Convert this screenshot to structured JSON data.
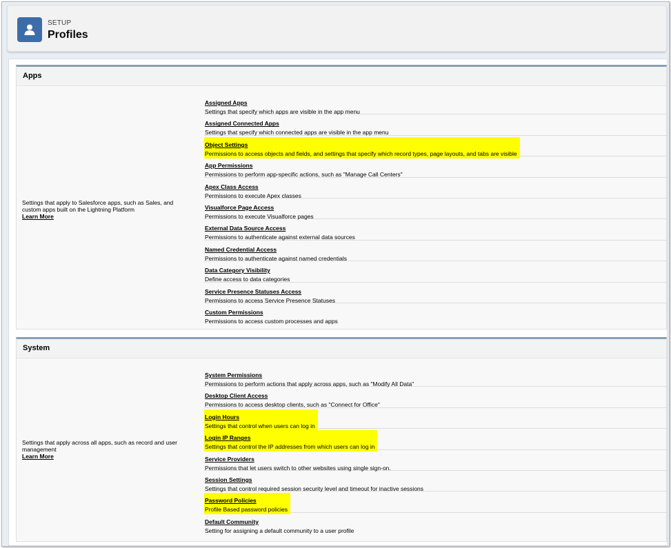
{
  "header": {
    "setup_label": "SETUP",
    "title": "Profiles",
    "icon": "user-icon"
  },
  "colors": {
    "highlight": "#ffff00",
    "icon_bg": "#3c6da8"
  },
  "apps": {
    "title": "Apps",
    "description": "Settings that apply to Salesforce apps, such as Sales, and custom apps built on the Lightning Platform",
    "learn_more": "Learn More",
    "items": [
      {
        "label": "Assigned Apps",
        "desc": "Settings that specify which apps are visible in the app menu"
      },
      {
        "label": "Assigned Connected Apps",
        "desc": "Settings that specify which connected apps are visible in the app menu"
      },
      {
        "label": "Object Settings",
        "desc": "Permissions to access objects and fields, and settings that specify which record types, page layouts, and tabs are visible"
      },
      {
        "label": "App Permissions",
        "desc": "Permissions to perform app-specific actions, such as \"Manage Call Centers\""
      },
      {
        "label": "Apex Class Access",
        "desc": "Permissions to execute Apex classes"
      },
      {
        "label": "Visualforce Page Access",
        "desc": "Permissions to execute Visualforce pages"
      },
      {
        "label": "External Data Source Access",
        "desc": "Permissions to authenticate against external data sources"
      },
      {
        "label": "Named Credential Access",
        "desc": "Permissions to authenticate against named credentials"
      },
      {
        "label": "Data Category Visibility",
        "desc": "Define access to data categories"
      },
      {
        "label": "Service Presence Statuses Access",
        "desc": "Permissions to access Service Presence Statuses"
      },
      {
        "label": "Custom Permissions",
        "desc": "Permissions to access custom processes and apps"
      }
    ]
  },
  "system": {
    "title": "System",
    "description": "Settings that apply across all apps, such as record and user management",
    "learn_more": "Learn More",
    "items": [
      {
        "label": "System Permissions",
        "desc": "Permissions to perform actions that apply across apps, such as \"Modify All Data\""
      },
      {
        "label": "Desktop Client Access",
        "desc": "Permissions to access desktop clients, such as \"Connect for Office\""
      },
      {
        "label": "Login Hours",
        "desc": "Settings that control when users can log in"
      },
      {
        "label": "Login IP Ranges",
        "desc": "Settings that control the IP addresses from which users can log in"
      },
      {
        "label": "Service Providers",
        "desc": "Permissions that let users switch to other websites using single sign-on."
      },
      {
        "label": "Session Settings",
        "desc": "Settings that control required session security level and timeout for inactive sessions"
      },
      {
        "label": "Password Policies",
        "desc": "Profile Based password policies"
      },
      {
        "label": "Default Community",
        "desc": "Setting for assigning a default community to a user profile"
      }
    ]
  }
}
